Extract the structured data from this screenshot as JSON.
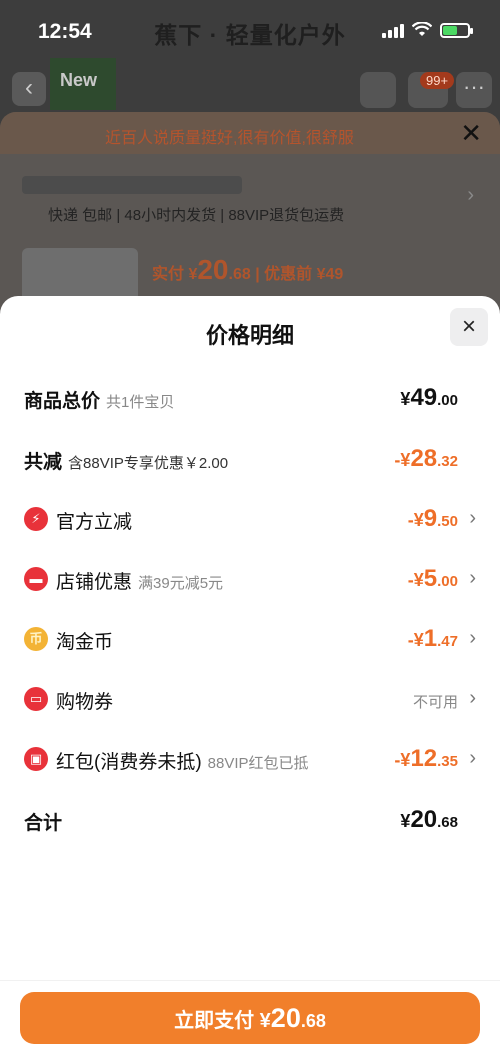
{
  "status": {
    "time": "12:54",
    "title": "蕉下 · 轻量化户外"
  },
  "background": {
    "new_label": "New",
    "cart_badge": "99+",
    "notice": "近百人说质量挺好,很有价值,很舒服",
    "shipping": "快递 包邮 | 48小时内发货 | 88VIP退货包运费",
    "price_prefix": "实付 ¥",
    "price_big": "20",
    "price_small": ".68",
    "price_before": " | 优惠前 ¥49"
  },
  "modal": {
    "title": "价格明细",
    "close_icon": "×",
    "rows": {
      "total": {
        "label": "商品总价",
        "sub": "共1件宝贝",
        "yen": "¥",
        "big": "49",
        "small": ".00"
      },
      "reduce": {
        "label": "共减",
        "sub": "含88VIP专享优惠￥2.00",
        "yen": "-¥",
        "big": "28",
        "small": ".32"
      },
      "official": {
        "label": "官方立减",
        "yen": "-¥",
        "big": "9",
        "small": ".50"
      },
      "shop": {
        "label": "店铺优惠",
        "sub": "满39元减5元",
        "yen": "-¥",
        "big": "5",
        "small": ".00"
      },
      "coin": {
        "label": "淘金币",
        "yen": "-¥",
        "big": "1",
        "small": ".47"
      },
      "coupon": {
        "label": "购物券",
        "value": "不可用"
      },
      "redpacket": {
        "label": "红包(消费券未抵)",
        "sub": "88VIP红包已抵",
        "yen": "-¥",
        "big": "12",
        "small": ".35"
      },
      "sum": {
        "label": "合计",
        "yen": "¥",
        "big": "20",
        "small": ".68"
      }
    }
  },
  "pay_button": {
    "prefix": "立即支付 ¥",
    "big": "20",
    "small": ".68"
  },
  "colors": {
    "accent": "#f17f2b",
    "discount": "#ee6e28",
    "icon_red": "#e8323a",
    "icon_gold": "#f3b335"
  }
}
